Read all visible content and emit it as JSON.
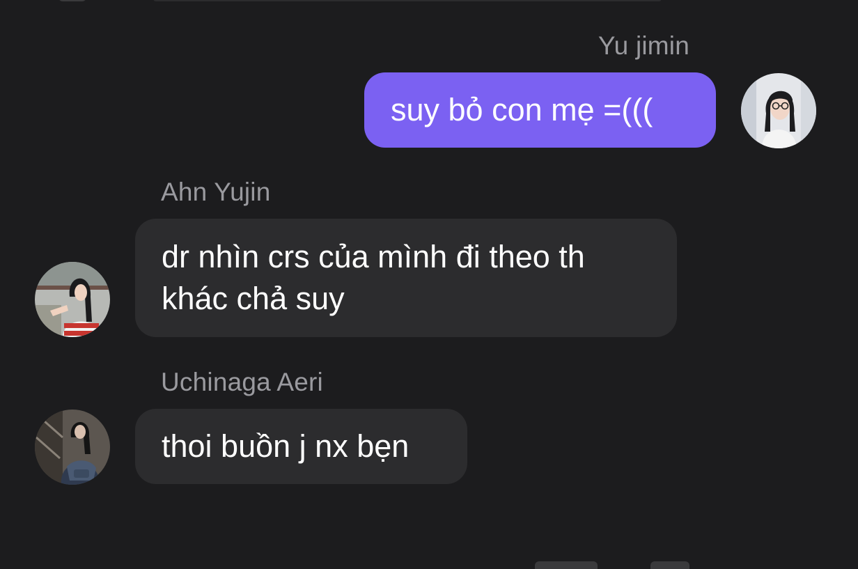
{
  "messages": [
    {
      "sender": "Yu jimin",
      "text": "suy bỏ con mẹ =(((",
      "direction": "outgoing",
      "avatar_icon": "profile-photo-girl-glasses-white-shirt"
    },
    {
      "sender": "Ahn Yujin",
      "text": "dr nhìn crs của mình đi theo th khác chả suy",
      "direction": "incoming",
      "avatar_icon": "profile-photo-girl-red-white-top"
    },
    {
      "sender": "Uchinaga Aeri",
      "text": "thoi buồn j nx bẹn",
      "direction": "incoming",
      "avatar_icon": "profile-photo-girl-dark-denim"
    }
  ],
  "colors": {
    "background": "#1c1c1e",
    "incoming_bubble": "#2c2c2e",
    "outgoing_bubble": "#7b61f2",
    "sender_name": "#9a9a9f",
    "message_text": "#ffffff"
  }
}
